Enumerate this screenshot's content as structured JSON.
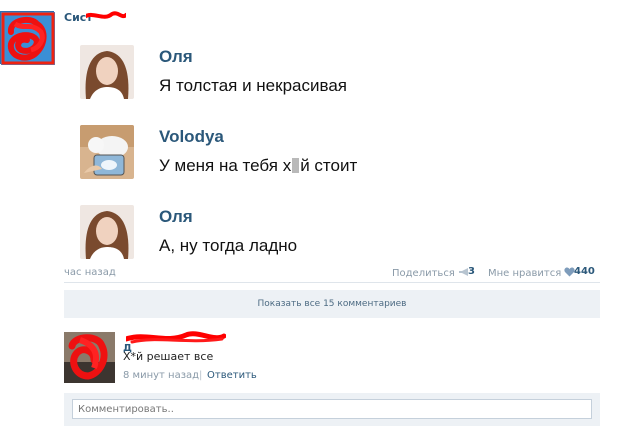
{
  "post": {
    "author": "Сист",
    "time": "час назад",
    "share_label": "Поделиться",
    "share_count": "3",
    "like_label": "Мне нравится",
    "like_count": "440"
  },
  "dialog": [
    {
      "name": "Оля",
      "text": "Я толстая и некрасивая"
    },
    {
      "name": "Volodya",
      "text": "У меня на тебя х",
      "text_tail": "й стоит"
    },
    {
      "name": "Оля",
      "text": "А, ну тогда ладно"
    }
  ],
  "comments": {
    "show_all_label": "Показать все 15 комментариев",
    "items": [
      {
        "author": "Д",
        "text": "Х*й решает все",
        "time": "8 минут назад",
        "separator": "|",
        "reply_label": "Ответить"
      }
    ]
  },
  "comment_box": {
    "placeholder": "Комментировать.."
  },
  "colors": {
    "link": "#2b587a",
    "muted": "#8a9aa8",
    "panel": "#edf1f5",
    "redaction": "#ff0000"
  }
}
